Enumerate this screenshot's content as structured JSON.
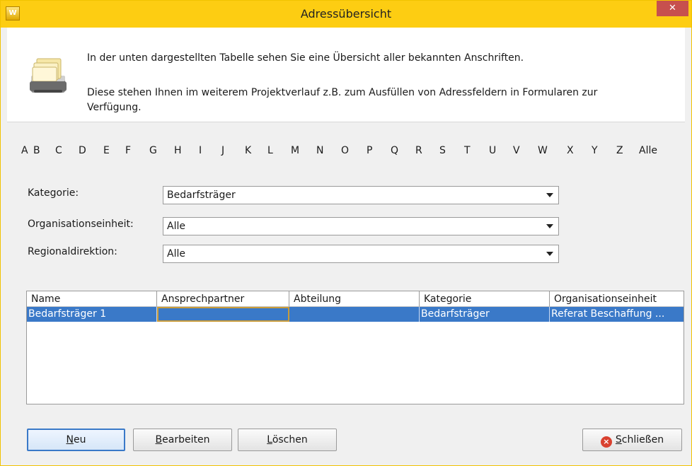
{
  "window": {
    "title": "Adressübersicht",
    "close_glyph": "✕",
    "app_icon_text": "W"
  },
  "info": {
    "line1": "In der unten dargestellten Tabelle sehen Sie eine Übersicht aller bekannten Anschriften.",
    "line2": "Diese stehen Ihnen im weiterem Projektverlauf z.B. zum Ausfüllen von Adressfeldern in Formularen zur Verfügung."
  },
  "alphabet": [
    "A",
    "B",
    "C",
    "D",
    "E",
    "F",
    "G",
    "H",
    "I",
    "J",
    "K",
    "L",
    "M",
    "N",
    "O",
    "P",
    "Q",
    "R",
    "S",
    "T",
    "U",
    "V",
    "W",
    "X",
    "Y",
    "Z",
    "Alle"
  ],
  "filters": {
    "kategorie": {
      "label": "Kategorie:",
      "value": "Bedarfsträger"
    },
    "organisationseinheit": {
      "label": "Organisationseinheit:",
      "value": "Alle"
    },
    "regionaldirektion": {
      "label": "Regionaldirektion:",
      "value": "Alle"
    }
  },
  "table": {
    "columns": [
      "Name",
      "Ansprechpartner",
      "Abteilung",
      "Kategorie",
      "Organisationseinheit"
    ],
    "rows": [
      [
        "Bedarfsträger 1",
        "",
        "",
        "Bedarfsträger",
        "Referat Beschaffung ..."
      ]
    ]
  },
  "buttons": {
    "neu": {
      "mnemonic": "N",
      "rest": "eu"
    },
    "bearbeiten": {
      "mnemonic": "B",
      "rest": "earbeiten"
    },
    "loeschen": {
      "mnemonic": "L",
      "rest": "öschen"
    },
    "schliessen": {
      "mnemonic": "S",
      "rest": "chließen",
      "icon": "×"
    }
  },
  "colors": {
    "titlebar": "#fdcd12",
    "selection": "#3a79c8",
    "close": "#c7504e"
  }
}
